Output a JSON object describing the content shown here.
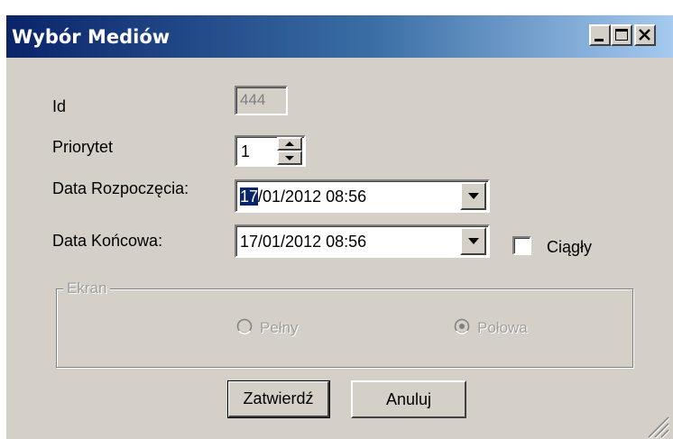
{
  "window": {
    "title": "Wybór Mediów"
  },
  "form": {
    "id_label": "Id",
    "id_value": "444",
    "priority_label": "Priorytet",
    "priority_value": "1",
    "start_label": "Data Rozpoczęcia:",
    "start_value_highlight": "17",
    "start_value_rest": "/01/2012 08:56",
    "end_label": "Data Końcowa:",
    "end_value": "17/01/2012 08:56",
    "continuous_label": "Ciągły",
    "continuous_checked": false
  },
  "screen_group": {
    "legend": "Ekran",
    "option_full": "Pełny",
    "option_half": "Połowa",
    "selected": "Połowa",
    "enabled": false
  },
  "buttons": {
    "confirm": "Zatwierdź",
    "cancel": "Anuluj"
  },
  "colors": {
    "face": "#d4d0c8",
    "title_start": "#0a246a",
    "title_end": "#a6caf0",
    "selection": "#0a246a"
  }
}
